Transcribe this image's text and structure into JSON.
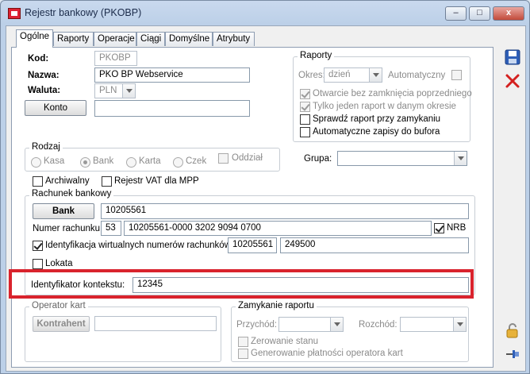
{
  "window": {
    "title": "Rejestr bankowy (PKOBP)",
    "min": "–",
    "max": "□",
    "close": "x"
  },
  "tabs": [
    "Ogólne",
    "Raporty",
    "Operacje",
    "Ciągi",
    "Domyślne",
    "Atrybuty"
  ],
  "general": {
    "kod_label": "Kod:",
    "kod_value": "PKOBP",
    "nazwa_label": "Nazwa:",
    "nazwa_value": "PKO BP Webservice",
    "waluta_label": "Waluta:",
    "waluta_value": "PLN",
    "konto_button": "Konto",
    "konto_value": ""
  },
  "raporty": {
    "title": "Raporty",
    "okres_label": "Okres:",
    "okres_value": "dzień",
    "automatyczny_label": "Automatyczny",
    "otwarcie_label": "Otwarcie bez zamknięcia poprzedniego",
    "jeden_label": "Tylko jeden raport w danym okresie",
    "sprawdz_label": "Sprawdź raport przy zamykaniu",
    "zapisy_label": "Automatyczne zapisy do bufora"
  },
  "rodzaj": {
    "title": "Rodzaj",
    "kasa": "Kasa",
    "bank": "Bank",
    "karta": "Karta",
    "czek": "Czek",
    "oddzial": "Oddział"
  },
  "grupa_label": "Grupa:",
  "archiwalny_label": "Archiwalny",
  "rejestr_vat_label": "Rejestr VAT dla MPP",
  "rachunek": {
    "title": "Rachunek bankowy",
    "bank_button": "Bank",
    "bank_value": "10205561",
    "numer_label": "Numer rachunku:",
    "numer_prefix": "53",
    "numer_value": "10205561-0000 3202 9094 0700",
    "nrb_label": "NRB",
    "ident_label": "Identyfikacja wirtualnych numerów rachunków",
    "ident_value1": "10205561",
    "ident_value2": "249500",
    "lokata_label": "Lokata"
  },
  "kontekst": {
    "label": "Identyfikator kontekstu:",
    "value": "12345"
  },
  "operator": {
    "title": "Operator kart",
    "kontrahent_button": "Kontrahent",
    "kontrahent_value": ""
  },
  "zamykanie": {
    "title": "Zamykanie raportu",
    "przychod_label": "Przychód:",
    "rozchod_label": "Rozchód:",
    "zerowanie_label": "Zerowanie stanu",
    "generowanie_label": "Generowanie płatności operatora kart"
  }
}
